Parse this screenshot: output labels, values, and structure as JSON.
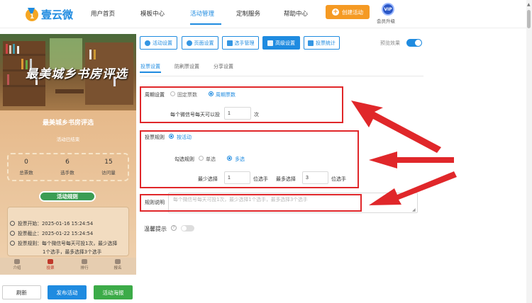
{
  "brand": {
    "name": "壹云微",
    "accent": "#1f8be0"
  },
  "nav": {
    "items": [
      "用户首页",
      "模板中心",
      "活动管理",
      "定制服务",
      "帮助中心"
    ],
    "active": "活动管理",
    "create_label": "创建活动",
    "vip_badge": "VIP",
    "vip_label": "会员升级"
  },
  "preview": {
    "banner_title": "最美城乡书房评选",
    "title": "最美城乡书房评选",
    "status": "活动已结束",
    "stats": [
      {
        "value": "0",
        "label": "总票数"
      },
      {
        "value": "6",
        "label": "选手数"
      },
      {
        "value": "15",
        "label": "访问量"
      }
    ],
    "rules_label": "活动规则",
    "info": [
      "投票开始：2025-01-16 15:24:54",
      "投票截止：2025-01-22 15:24:54",
      "投票规则：每个微信号每天可投1次，最少选择",
      "1个选手，最多选择3个选手"
    ],
    "tabs": [
      "介绍",
      "投票",
      "排行",
      "报名"
    ],
    "active_tab": "投票"
  },
  "actions": {
    "refresh": "刷新",
    "publish": "发布活动",
    "poster": "活动海报"
  },
  "toolbar": {
    "buttons": [
      "活动设置",
      "页面设置",
      "选手管理",
      "高级设置",
      "投票统计"
    ],
    "active": "高级设置",
    "preview_effect": "预览效果",
    "preview_on": true
  },
  "subtabs": {
    "items": [
      "投票设置",
      "防刷票设置",
      "分享设置"
    ],
    "active": "投票设置"
  },
  "form": {
    "cycle": {
      "label": "周期设置",
      "options": [
        "固定票数",
        "周期票数"
      ],
      "selected": "周期票数",
      "per_day_label": "每个微信号每天可以投",
      "per_day_value": "1",
      "per_day_unit": "次"
    },
    "vote_rule": {
      "label": "投票规则",
      "option": "按活动",
      "selected": true,
      "select_rule_label": "勾选规则",
      "select_options": [
        "单选",
        "多选"
      ],
      "select_selected": "多选",
      "min_label": "最少选择",
      "min_value": "1",
      "min_unit": "位选手",
      "max_label": "最多选择",
      "max_value": "3",
      "max_unit": "位选手"
    },
    "rule_desc": {
      "label": "规则说明",
      "placeholder": "每个微信号每天可投1次，最少选择1个选手，最多选择3个选手"
    },
    "tips": {
      "label": "温馨提示",
      "help": "?",
      "enabled": false
    }
  },
  "annotation": {
    "box_color": "#e0272a"
  }
}
